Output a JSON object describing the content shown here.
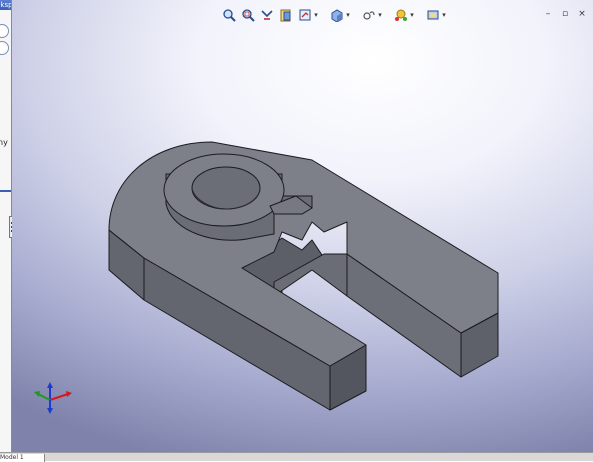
{
  "left_panel": {
    "header_title": "Eksport Wymiarów",
    "text_fragment": "ny"
  },
  "toolbar": {
    "tools": [
      {
        "name": "zoom-to-fit-icon",
        "has_dropdown": false
      },
      {
        "name": "zoom-to-area-icon",
        "has_dropdown": false
      },
      {
        "name": "previous-view-icon",
        "has_dropdown": false
      },
      {
        "name": "section-view-icon",
        "has_dropdown": false
      },
      {
        "name": "view-orientation-icon",
        "has_dropdown": true
      },
      {
        "name": "display-style-icon",
        "has_dropdown": true
      },
      {
        "name": "hide-show-items-icon",
        "has_dropdown": true
      },
      {
        "name": "edit-appearance-icon",
        "has_dropdown": true
      },
      {
        "name": "view-settings-icon",
        "has_dropdown": true
      }
    ]
  },
  "window_controls": {
    "minimize": "–",
    "restore": "▫",
    "close": "×"
  },
  "status_bar": {
    "tab_label": "Model 1"
  },
  "colors": {
    "model_top": "#7e8088",
    "model_side_light": "#70737c",
    "model_side_dark": "#5a5d66",
    "axis_x": "#d21a1a",
    "axis_y": "#1e9a1e",
    "axis_z": "#1a3ad2"
  }
}
